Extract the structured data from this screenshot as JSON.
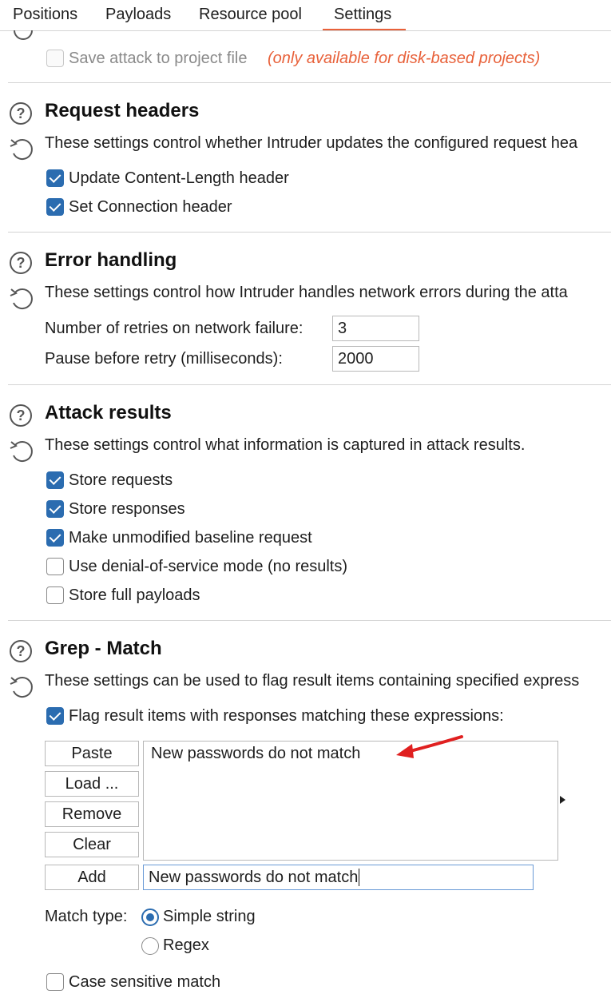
{
  "tabs": [
    "Positions",
    "Payloads",
    "Resource pool",
    "Settings"
  ],
  "active_tab": "Settings",
  "save_attack": {
    "label": "Save attack to project file",
    "note": "(only available for disk-based projects)",
    "checked": false,
    "disabled": true
  },
  "request_headers": {
    "title": "Request headers",
    "description": "These settings control whether Intruder updates the configured request hea",
    "options": [
      {
        "label": "Update Content-Length header",
        "checked": true
      },
      {
        "label": "Set Connection header",
        "checked": true
      }
    ]
  },
  "error_handling": {
    "title": "Error handling",
    "description": "These settings control how Intruder handles network errors during the atta",
    "retries_label": "Number of retries on network failure:",
    "retries_value": "3",
    "pause_label": "Pause before retry (milliseconds):",
    "pause_value": "2000"
  },
  "attack_results": {
    "title": "Attack results",
    "description": "These settings control what information is captured in attack results.",
    "options": [
      {
        "label": "Store requests",
        "checked": true
      },
      {
        "label": "Store responses",
        "checked": true
      },
      {
        "label": "Make unmodified baseline request",
        "checked": true
      },
      {
        "label": "Use denial-of-service mode (no results)",
        "checked": false
      },
      {
        "label": "Store full payloads",
        "checked": false
      }
    ]
  },
  "grep_match": {
    "title": "Grep - Match",
    "description": "These settings can be used to flag result items containing specified express",
    "flag_label": "Flag result items with responses matching these expressions:",
    "flag_checked": true,
    "buttons": {
      "paste": "Paste",
      "load": "Load ...",
      "remove": "Remove",
      "clear": "Clear",
      "add": "Add"
    },
    "list_items": [
      "New passwords do not match"
    ],
    "add_input_value": "New passwords do not match",
    "match_type_label": "Match type:",
    "match_types": [
      {
        "label": "Simple string",
        "selected": true
      },
      {
        "label": "Regex",
        "selected": false
      }
    ],
    "case_sensitive_label": "Case sensitive match",
    "case_sensitive_checked": false
  },
  "colors": {
    "accent": "#e8613a",
    "checkbox": "#2b6cb0",
    "note": "#e8613a",
    "arrow": "#e02020"
  }
}
